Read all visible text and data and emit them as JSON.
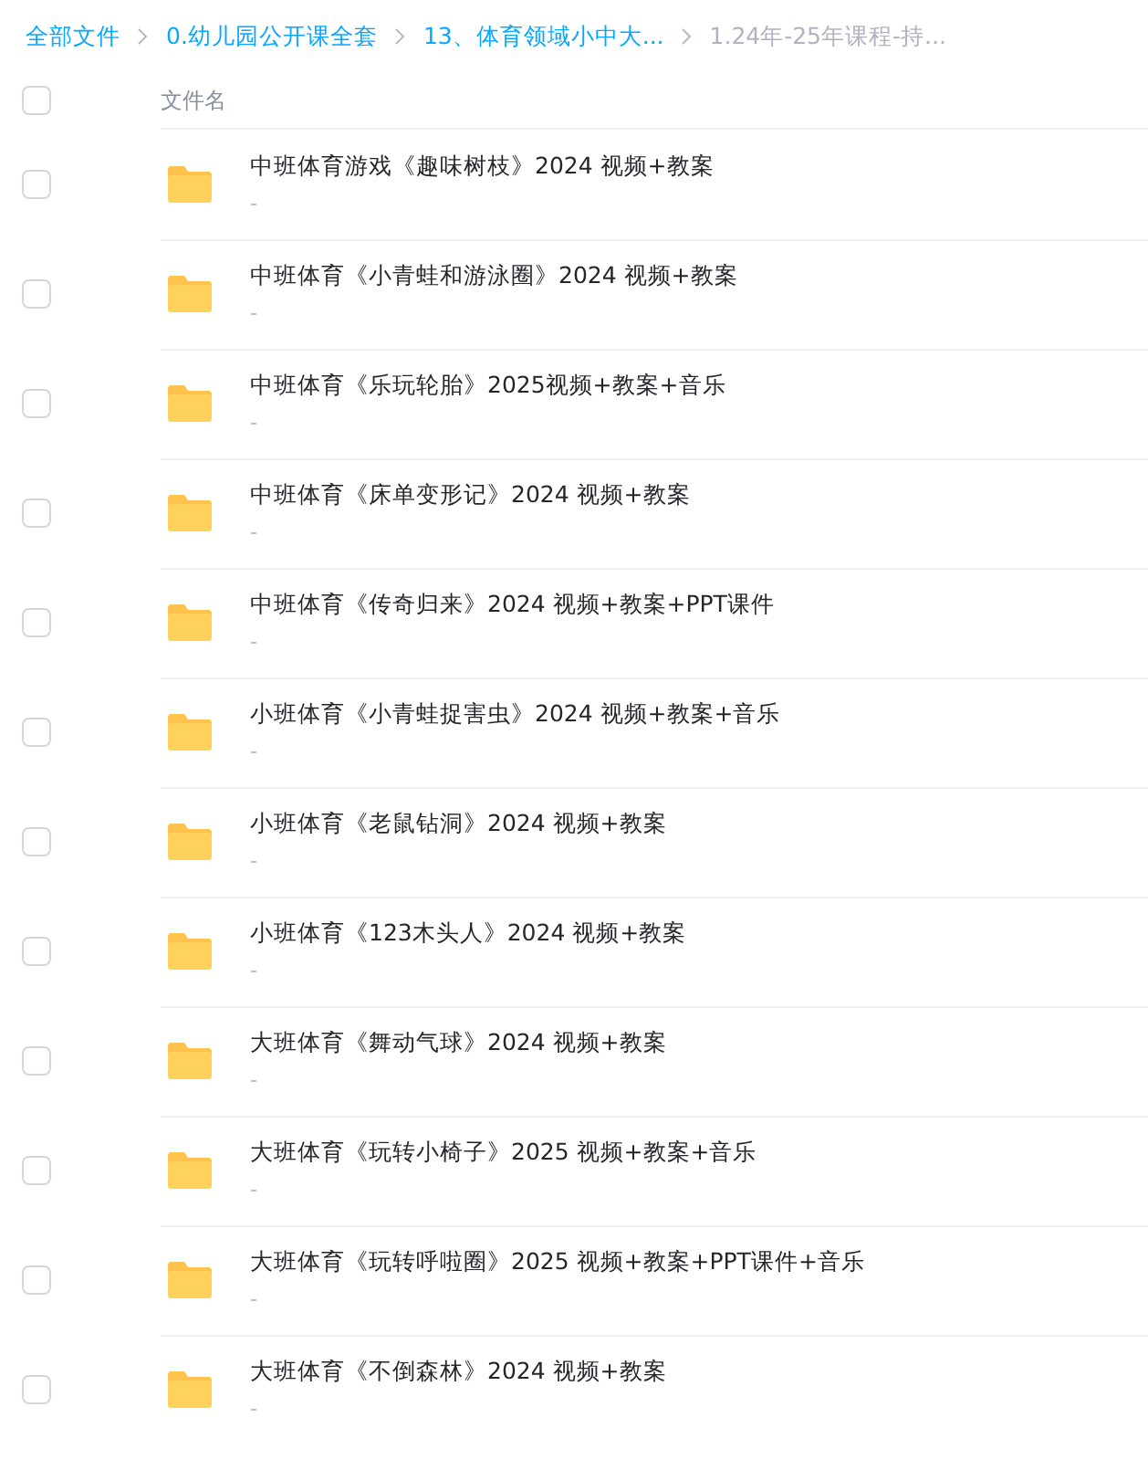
{
  "breadcrumb": [
    {
      "label": "全部文件",
      "current": false
    },
    {
      "label": "0.幼儿园公开课全套",
      "current": false
    },
    {
      "label": "13、体育领域小中大...",
      "current": false
    },
    {
      "label": "1.24年-25年课程-持...",
      "current": true
    }
  ],
  "header": {
    "checked": false,
    "column_1": "文件名"
  },
  "files": [
    {
      "name": "中班体育游戏《趣味树枝》2024 视频+教案",
      "detail": "-",
      "checked": false
    },
    {
      "name": "中班体育《小青蛙和游泳圈》2024 视频+教案",
      "detail": "-",
      "checked": false
    },
    {
      "name": "中班体育《乐玩轮胎》2025视频+教案+音乐",
      "detail": "-",
      "checked": false
    },
    {
      "name": "中班体育《床单变形记》2024 视频+教案",
      "detail": "-",
      "checked": false
    },
    {
      "name": "中班体育《传奇归来》2024 视频+教案+PPT课件",
      "detail": "-",
      "checked": false
    },
    {
      "name": "小班体育《小青蛙捉害虫》2024 视频+教案+音乐",
      "detail": "-",
      "checked": false
    },
    {
      "name": "小班体育《老鼠钻洞》2024 视频+教案",
      "detail": "-",
      "checked": false
    },
    {
      "name": "小班体育《123木头人》2024 视频+教案",
      "detail": "-",
      "checked": false
    },
    {
      "name": "大班体育《舞动气球》2024 视频+教案",
      "detail": "-",
      "checked": false
    },
    {
      "name": "大班体育《玩转小椅子》2025 视频+教案+音乐",
      "detail": "-",
      "checked": false
    },
    {
      "name": "大班体育《玩转呼啦圈》2025 视频+教案+PPT课件+音乐",
      "detail": "-",
      "checked": false
    },
    {
      "name": "大班体育《不倒森林》2024 视频+教案",
      "detail": "-",
      "checked": false
    }
  ]
}
